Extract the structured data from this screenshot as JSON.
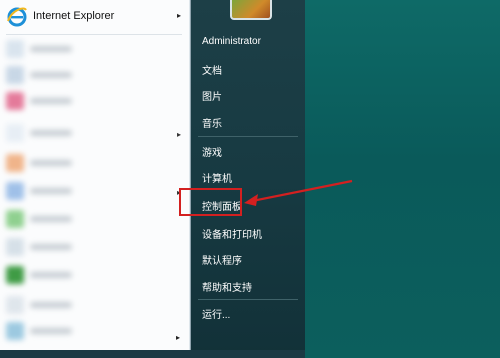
{
  "start_menu": {
    "pinned_item": {
      "label": "Internet Explorer"
    },
    "right_items": [
      {
        "label": "Administrator"
      },
      {
        "label": "文档"
      },
      {
        "label": "图片"
      },
      {
        "label": "音乐"
      },
      {
        "label": "游戏"
      },
      {
        "label": "计算机"
      },
      {
        "label": "控制面板"
      },
      {
        "label": "设备和打印机"
      },
      {
        "label": "默认程序"
      },
      {
        "label": "帮助和支持"
      },
      {
        "label": "运行..."
      }
    ],
    "submenu_arrow": "▸"
  },
  "annotation": {
    "highlight_color": "#d32020"
  },
  "colors": {
    "desktop": "#0e6a67",
    "right_pane": "#173a42",
    "left_pane": "#fbfcfd"
  }
}
